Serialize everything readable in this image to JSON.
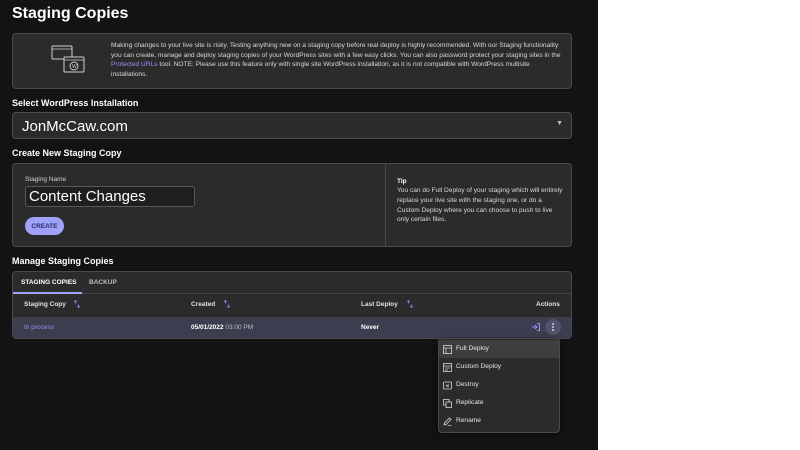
{
  "page": {
    "title": "Staging Copies"
  },
  "info": {
    "text_before_link": "Making changes to your live site is risky. Testing anything new on a staging copy before real deploy is highly recommended. With our Staging functionality you can create, manage and deploy staging copies of your WordPress sites with a few easy clicks. You can also password protect your staging sites in the ",
    "link_text": "Protected URLs",
    "text_after_link": " tool. NOTE: Please use this feature only with single site WordPress installation, as it is not compatible with WordPress multisite installations."
  },
  "select_installation": {
    "title": "Select WordPress Installation",
    "value": "JonMcCaw.com"
  },
  "create": {
    "title": "Create New Staging Copy",
    "field_label": "Staging Name",
    "field_value": "Content Changes",
    "button_label": "CREATE",
    "tip_title": "Tip",
    "tip_text": "You can do Full Deploy of your staging which will entirely replace your live site with the staging one, or do a Custom Deploy where you can choose to push to live only certain files."
  },
  "manage": {
    "title": "Manage Staging Copies",
    "tabs": [
      "STAGING COPIES",
      "BACKUP"
    ],
    "columns": [
      "Staging Copy",
      "Created",
      "Last Deploy",
      "Actions"
    ],
    "row": {
      "status": "In process",
      "created_date": "05/01/2022",
      "created_time": "03:00 PM",
      "last_deploy": "Never"
    }
  },
  "menu": {
    "items": [
      {
        "label": "Full Deploy",
        "icon": "full-deploy-icon"
      },
      {
        "label": "Custom Deploy",
        "icon": "custom-deploy-icon"
      },
      {
        "label": "Destroy",
        "icon": "destroy-icon"
      },
      {
        "label": "Replicate",
        "icon": "replicate-icon"
      },
      {
        "label": "Rename",
        "icon": "rename-icon"
      }
    ]
  },
  "colors": {
    "accent": "#9ea2f8",
    "link": "#8f93f7",
    "background": "#131313",
    "panel": "#2b2b2b"
  }
}
